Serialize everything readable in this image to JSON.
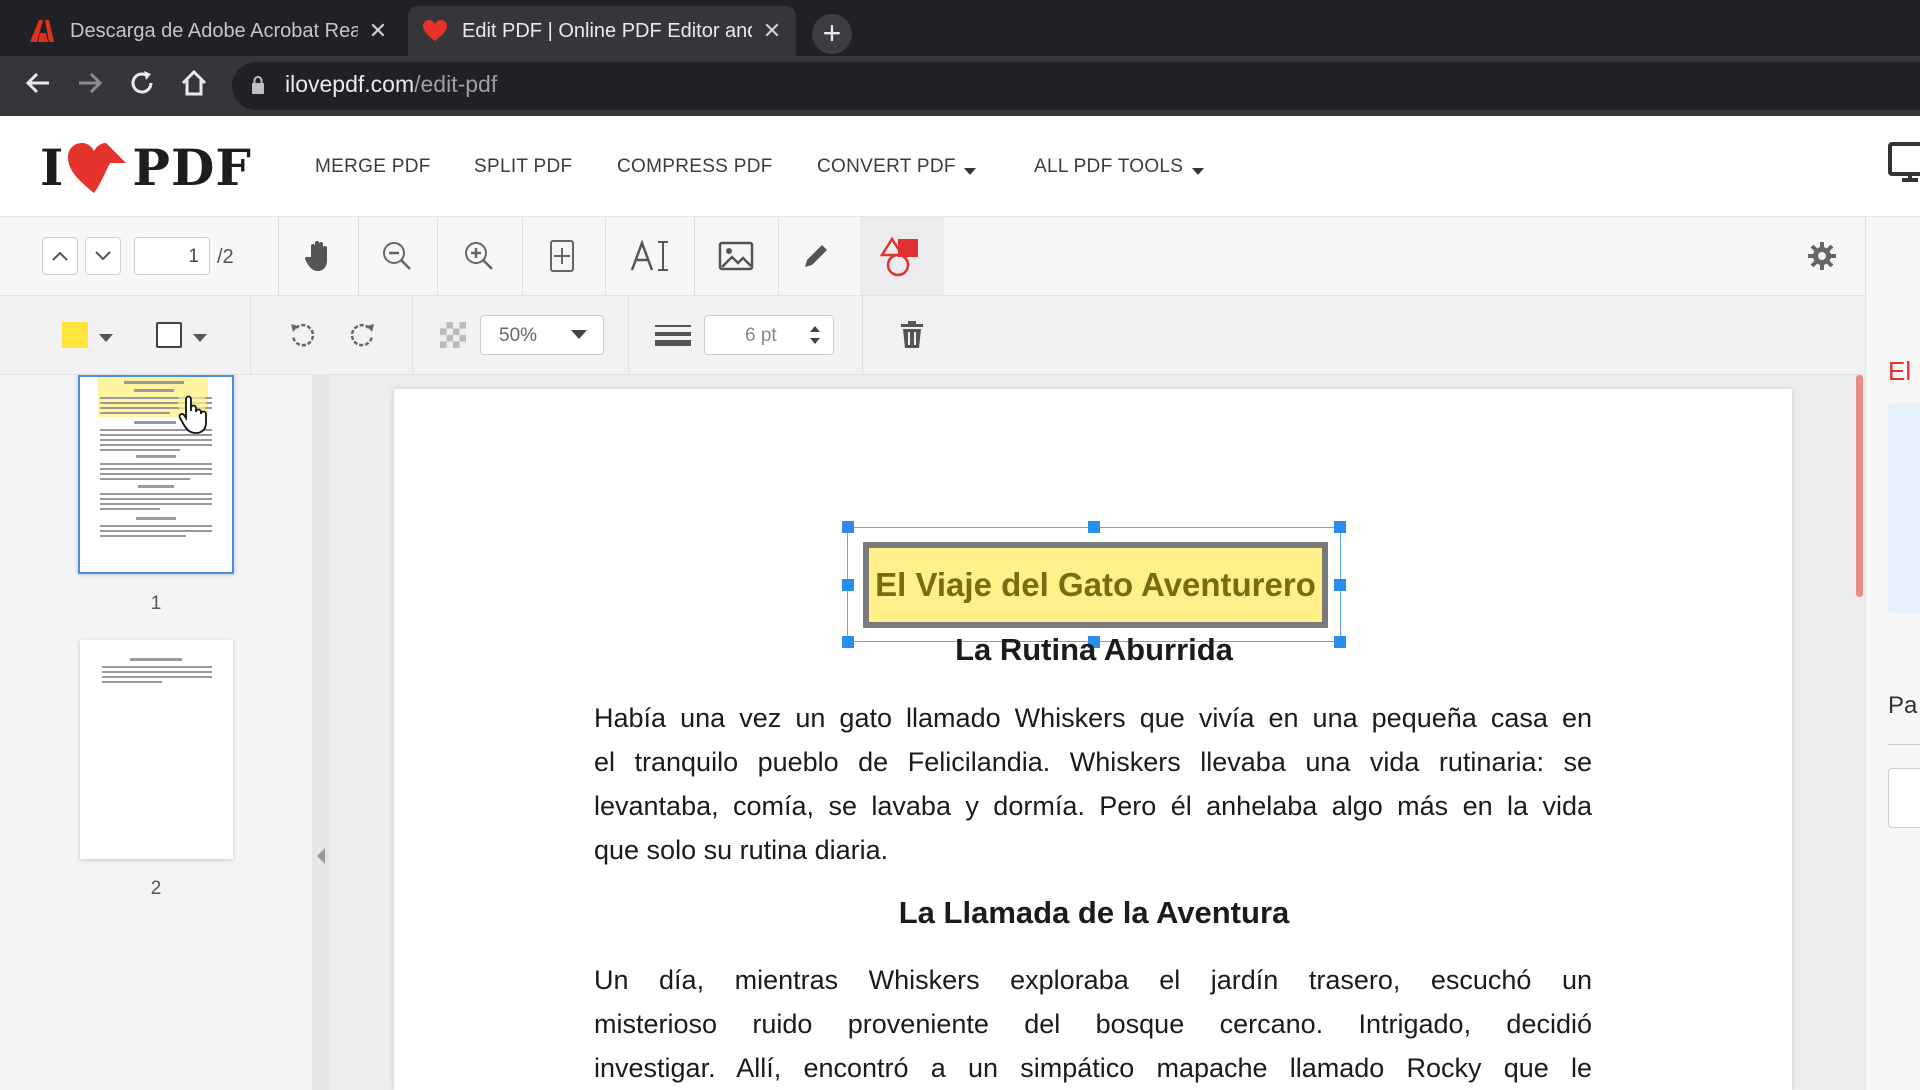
{
  "browser": {
    "tabs": [
      {
        "title": "Descarga de Adobe Acrobat Reader",
        "close": "✕"
      },
      {
        "title": "Edit PDF | Online PDF Editor and",
        "close": "✕"
      }
    ],
    "new_tab": "+",
    "url_domain": "ilovepdf.com",
    "url_path": "/edit-pdf"
  },
  "site": {
    "logo_left": "I",
    "logo_right": "PDF",
    "nav": [
      "MERGE PDF",
      "SPLIT PDF",
      "COMPRESS PDF",
      "CONVERT PDF",
      "ALL PDF TOOLS"
    ]
  },
  "toolbar": {
    "page_current": "1",
    "page_total": "/2",
    "opacity": "50%",
    "stroke_width": "6 pt",
    "colors": {
      "fill": "#ffe53b",
      "shape_stroke": "#e03030"
    }
  },
  "thumbnails": [
    {
      "number": "1"
    },
    {
      "number": "2"
    }
  ],
  "document": {
    "title_box": "El Viaje del Gato Aventurero",
    "heading1": "La Rutina Aburrida",
    "para1_lines": [
      "Había una vez un gato llamado Whiskers que vivía en una pequeña casa en",
      "el tranquilo pueblo de Felicilandia. Whiskers llevaba una vida rutinaria: se",
      "levantaba, comía, se lavaba y dormía. Pero él anhelaba algo más en la vida",
      "que solo su rutina diaria."
    ],
    "heading2": "La Llamada de la Aventura",
    "para2_lines": [
      "Un día, mientras Whiskers exploraba el jardín trasero, escuchó un",
      "misterioso ruido proveniente del bosque cercano. Intrigado, decidió",
      "investigar. Allí, encontró a un simpático mapache llamado Rocky que le"
    ]
  },
  "right_panel": {
    "label1": "El",
    "label2": "Pa"
  }
}
